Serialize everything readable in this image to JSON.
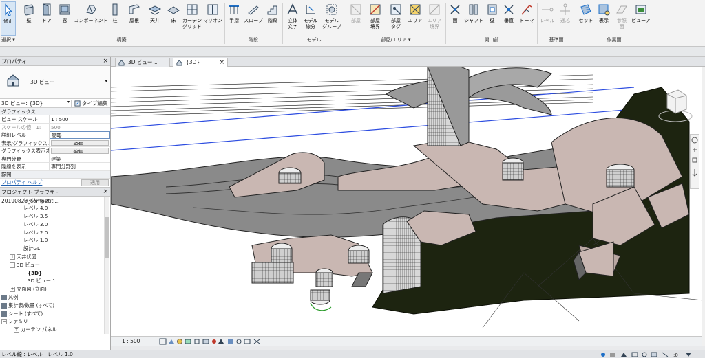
{
  "ribbon": {
    "buttons": {
      "modify": "修正",
      "wall": "壁",
      "door": "ドア",
      "window": "窓",
      "component": "コンポーネント",
      "column": "柱",
      "roof": "屋根",
      "ceiling": "天井",
      "floor": "床",
      "curtain_grid": "カーテン\nグリッド",
      "mullion": "マリオン",
      "railing": "手摺",
      "ramp": "スロープ",
      "stair": "階段",
      "model_text": "立体\n文字",
      "model_line": "モデル\n線分",
      "model_group": "モデル\nグループ",
      "room": "部屋",
      "room_separator": "部屋\n境界",
      "room_tag": "部屋\nタグ",
      "area": "エリア",
      "area_boundary": "エリア\n境界",
      "by_face": "面",
      "shaft": "シャフト",
      "wall_opening": "壁",
      "vertical": "垂直",
      "dormer": "ドーマ",
      "level": "レベル",
      "grid": "通芯",
      "set": "セット",
      "show": "表示",
      "ref_plane": "参照\n面",
      "viewer": "ビューア"
    },
    "panels": {
      "select": "選択 ▾",
      "build": "構築",
      "circulation": "階段",
      "model": "モデル",
      "room_area": "部屋/エリア ▾",
      "opening": "開口部",
      "datum": "基準面",
      "work_plane": "作業面"
    }
  },
  "properties": {
    "title": "プロパティ",
    "type_name": "3D ビュー",
    "selector": "3D ビュー: {3D}",
    "edit_type": "タイプ編集",
    "group_graphics": "グラフィックス",
    "rows": [
      {
        "k": "ビュー スケール",
        "v": "1 : 500"
      },
      {
        "k": "スケールの値　1:",
        "v": "500"
      },
      {
        "k": "詳細レベル",
        "v": "簡略"
      },
      {
        "k": "表示/グラフィックス...",
        "v": "編集..."
      },
      {
        "k": "グラフィックス表示オ...",
        "v": "編集..."
      },
      {
        "k": "専門分野",
        "v": "建築"
      },
      {
        "k": "隠線を表示",
        "v": "専門分野別"
      }
    ],
    "group_extents": "範囲",
    "help_link": "プロパティ ヘルプ",
    "apply": "適用"
  },
  "browser": {
    "title": "プロジェクト ブラウザ - 20190823_competiti...",
    "items": [
      "レベル 5.0",
      "レベル 4.0",
      "レベル 3.5",
      "レベル 3.0",
      "レベル 2.0",
      "レベル 1.0",
      "設計GL",
      "天井伏図",
      "3D ビュー",
      "{3D}",
      "3D ビュー 1",
      "立面図 (立面)",
      "凡例",
      "集計表/数量 (すべて)",
      "シート (すべて)",
      "ファミリ",
      "カーテン パネル"
    ]
  },
  "tabs": {
    "tab1": "3D ビュー 1",
    "tab2": "{3D}"
  },
  "viewbar": {
    "scale": "1 : 500"
  },
  "status": {
    "text": "レベル線 : レベル : レベル 1.0"
  },
  "colors": {
    "accent": "#1e6fc7",
    "roof_pink": "#c9b7b2",
    "ground_dark": "#1d2410",
    "mass_gray": "#858585"
  }
}
